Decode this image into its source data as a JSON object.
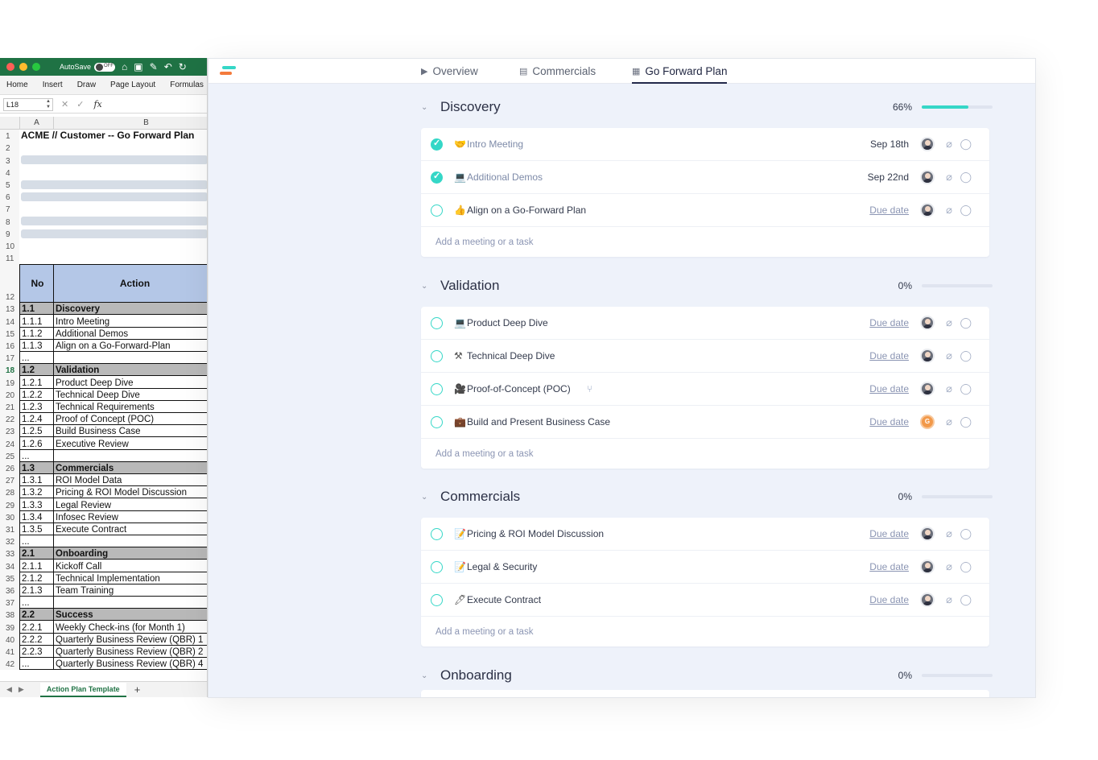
{
  "excel": {
    "autosave_label": "AutoSave",
    "autosave_state": "OFF",
    "ribbon_tabs": [
      "Home",
      "Insert",
      "Draw",
      "Page Layout",
      "Formulas"
    ],
    "name_box": "L18",
    "col_a": "A",
    "col_b": "B",
    "title": "ACME // Customer -- Go Forward Plan",
    "header_no": "No",
    "header_action": "Action",
    "rows": [
      {
        "n": "13",
        "a": "1.1",
        "b": "Discovery",
        "section": true
      },
      {
        "n": "14",
        "a": "1.1.1",
        "b": "Intro Meeting"
      },
      {
        "n": "15",
        "a": "1.1.2",
        "b": "Additional Demos"
      },
      {
        "n": "16",
        "a": "1.1.3",
        "b": "Align on a Go-Forward-Plan"
      },
      {
        "n": "17",
        "a": "...",
        "b": ""
      },
      {
        "n": "18",
        "a": "1.2",
        "b": "Validation",
        "section": true
      },
      {
        "n": "19",
        "a": "1.2.1",
        "b": "Product Deep Dive"
      },
      {
        "n": "20",
        "a": "1.2.2",
        "b": "Technical Deep Dive"
      },
      {
        "n": "21",
        "a": "1.2.3",
        "b": "Technical Requirements"
      },
      {
        "n": "22",
        "a": "1.2.4",
        "b": "Proof of Concept (POC)"
      },
      {
        "n": "23",
        "a": "1.2.5",
        "b": "Build Business Case"
      },
      {
        "n": "24",
        "a": "1.2.6",
        "b": "Executive Review"
      },
      {
        "n": "25",
        "a": "...",
        "b": ""
      },
      {
        "n": "26",
        "a": "1.3",
        "b": "Commercials",
        "section": true
      },
      {
        "n": "27",
        "a": "1.3.1",
        "b": "ROI Model Data"
      },
      {
        "n": "28",
        "a": "1.3.2",
        "b": "Pricing & ROI Model Discussion"
      },
      {
        "n": "29",
        "a": "1.3.3",
        "b": "Legal Review"
      },
      {
        "n": "30",
        "a": "1.3.4",
        "b": "Infosec Review"
      },
      {
        "n": "31",
        "a": "1.3.5",
        "b": "Execute Contract"
      },
      {
        "n": "32",
        "a": "...",
        "b": ""
      },
      {
        "n": "33",
        "a": "2.1",
        "b": "Onboarding",
        "section": true
      },
      {
        "n": "34",
        "a": "2.1.1",
        "b": "Kickoff Call"
      },
      {
        "n": "35",
        "a": "2.1.2",
        "b": "Technical Implementation"
      },
      {
        "n": "36",
        "a": "2.1.3",
        "b": "Team Training"
      },
      {
        "n": "37",
        "a": "...",
        "b": ""
      },
      {
        "n": "38",
        "a": "2.2",
        "b": "Success",
        "section": true
      },
      {
        "n": "39",
        "a": "2.2.1",
        "b": "Weekly Check-ins (for Month 1)"
      },
      {
        "n": "40",
        "a": "2.2.2",
        "b": "Quarterly Business Review (QBR) 1"
      },
      {
        "n": "41",
        "a": "2.2.3",
        "b": "Quarterly Business Review (QBR) 2"
      },
      {
        "n": "42",
        "a": "...",
        "b": "Quarterly Business Review (QBR) 4"
      }
    ],
    "sheet_tab": "Action Plan Template",
    "add_sheet": "+"
  },
  "app": {
    "tabs": [
      {
        "label": "Overview",
        "icon": "play-square-icon"
      },
      {
        "label": "Commercials",
        "icon": "document-icon"
      },
      {
        "label": "Go Forward Plan",
        "icon": "calendar-icon",
        "active": true
      }
    ],
    "add_task_label": "Add a meeting or a task",
    "sections": [
      {
        "title": "Discovery",
        "progress_label": "66%",
        "progress": 0.66,
        "tasks": [
          {
            "emoji": "🤝",
            "name": "Intro Meeting",
            "due": "Sep 18th",
            "done": true
          },
          {
            "emoji": "💻",
            "name": "Additional Demos",
            "due": "Sep 22nd",
            "done": true
          },
          {
            "emoji": "👍",
            "name": "Align on a Go-Forward Plan",
            "due": "Due date",
            "done": false
          }
        ]
      },
      {
        "title": "Validation",
        "progress_label": "0%",
        "progress": 0,
        "tasks": [
          {
            "emoji": "💻",
            "name": "Product Deep Dive",
            "due": "Due date",
            "done": false
          },
          {
            "emoji": "⚒",
            "name": "Technical Deep Dive",
            "due": "Due date",
            "done": false
          },
          {
            "emoji": "🎥",
            "name": "Proof-of-Concept (POC)",
            "due": "Due date",
            "done": false,
            "has_subtasks": true
          },
          {
            "emoji": "💼",
            "name": "Build and Present Business Case",
            "due": "Due date",
            "done": false,
            "avatar_letter": "G"
          }
        ]
      },
      {
        "title": "Commercials",
        "progress_label": "0%",
        "progress": 0,
        "tasks": [
          {
            "emoji": "📝",
            "name": "Pricing & ROI Model Discussion",
            "due": "Due date",
            "done": false
          },
          {
            "emoji": "📝",
            "name": "Legal & Security",
            "due": "Due date",
            "done": false
          },
          {
            "emoji": "🖊",
            "name": "Execute Contract",
            "due": "Due date",
            "done": false
          }
        ]
      },
      {
        "title": "Onboarding",
        "progress_label": "0%",
        "progress": 0,
        "tasks": []
      }
    ]
  }
}
